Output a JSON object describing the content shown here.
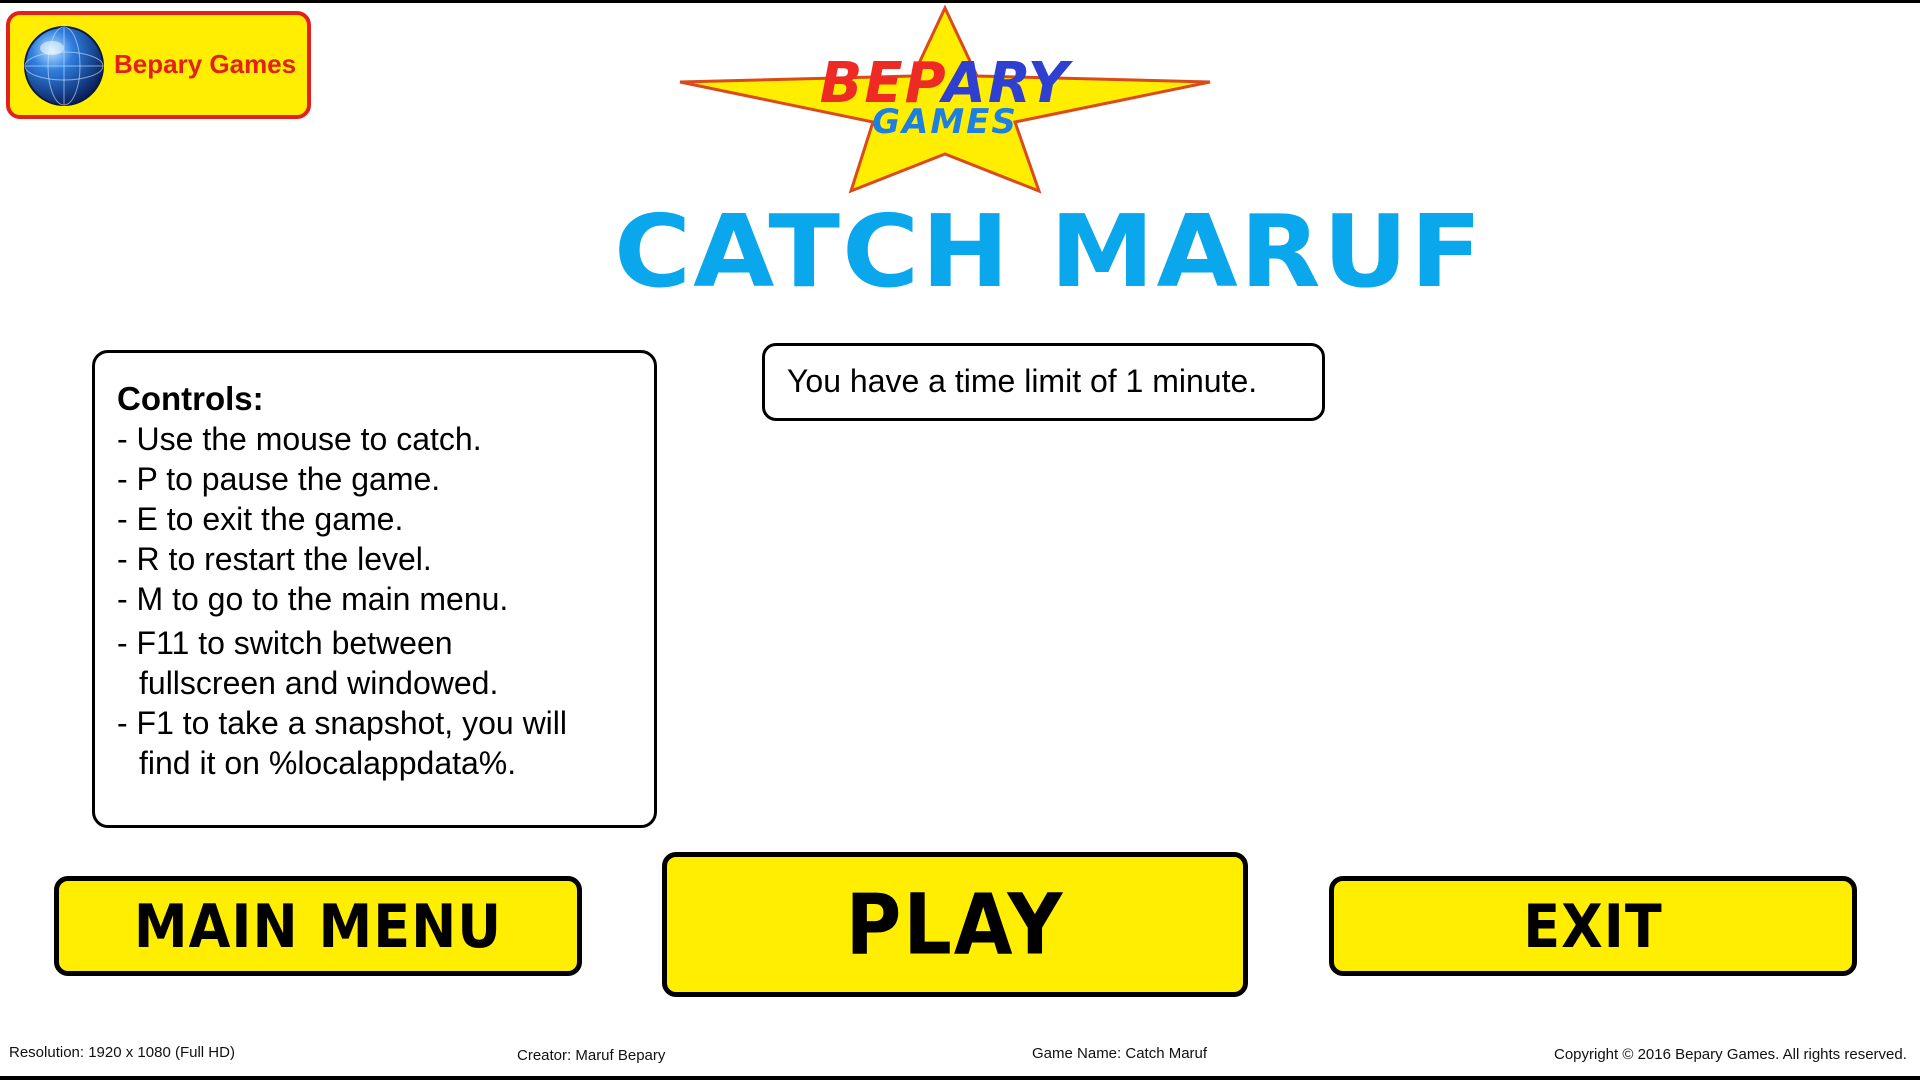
{
  "brand": {
    "name": "Bepary Games",
    "icon": "globe-icon",
    "colors": {
      "badge_bg": "#ffee00",
      "badge_border": "#e3201b",
      "text": "#e3201b"
    }
  },
  "logo": {
    "top_part1": "BEP",
    "top_part2": "ARY",
    "bottom": "GAMES",
    "star_color": "#ffee00"
  },
  "game_title": "CATCH MARUF",
  "controls": {
    "title": "Controls:",
    "items": [
      "- Use the mouse to catch.",
      "- P to pause the game.",
      "- E to exit the game.",
      "- R to restart the level.",
      "- M to go to the main menu."
    ],
    "f11_line1": "- F11 to switch between",
    "f11_line2": "fullscreen and windowed.",
    "f1_line1": "- F1 to take a snapshot, you will",
    "f1_line2": "find it on %localappdata%."
  },
  "info": "You have a time limit of 1 minute.",
  "buttons": {
    "main_menu": "MAIN MENU",
    "play": "PLAY",
    "exit": "EXIT",
    "color": "#ffee00"
  },
  "footer": {
    "resolution": "Resolution: 1920 x 1080 (Full HD)",
    "creator": "Creator: Maruf Bepary",
    "game_name": "Game Name: Catch Maruf",
    "copyright": "Copyright © 2016 Bepary Games. All rights reserved."
  },
  "accent_title_color": "#0aa7ec"
}
